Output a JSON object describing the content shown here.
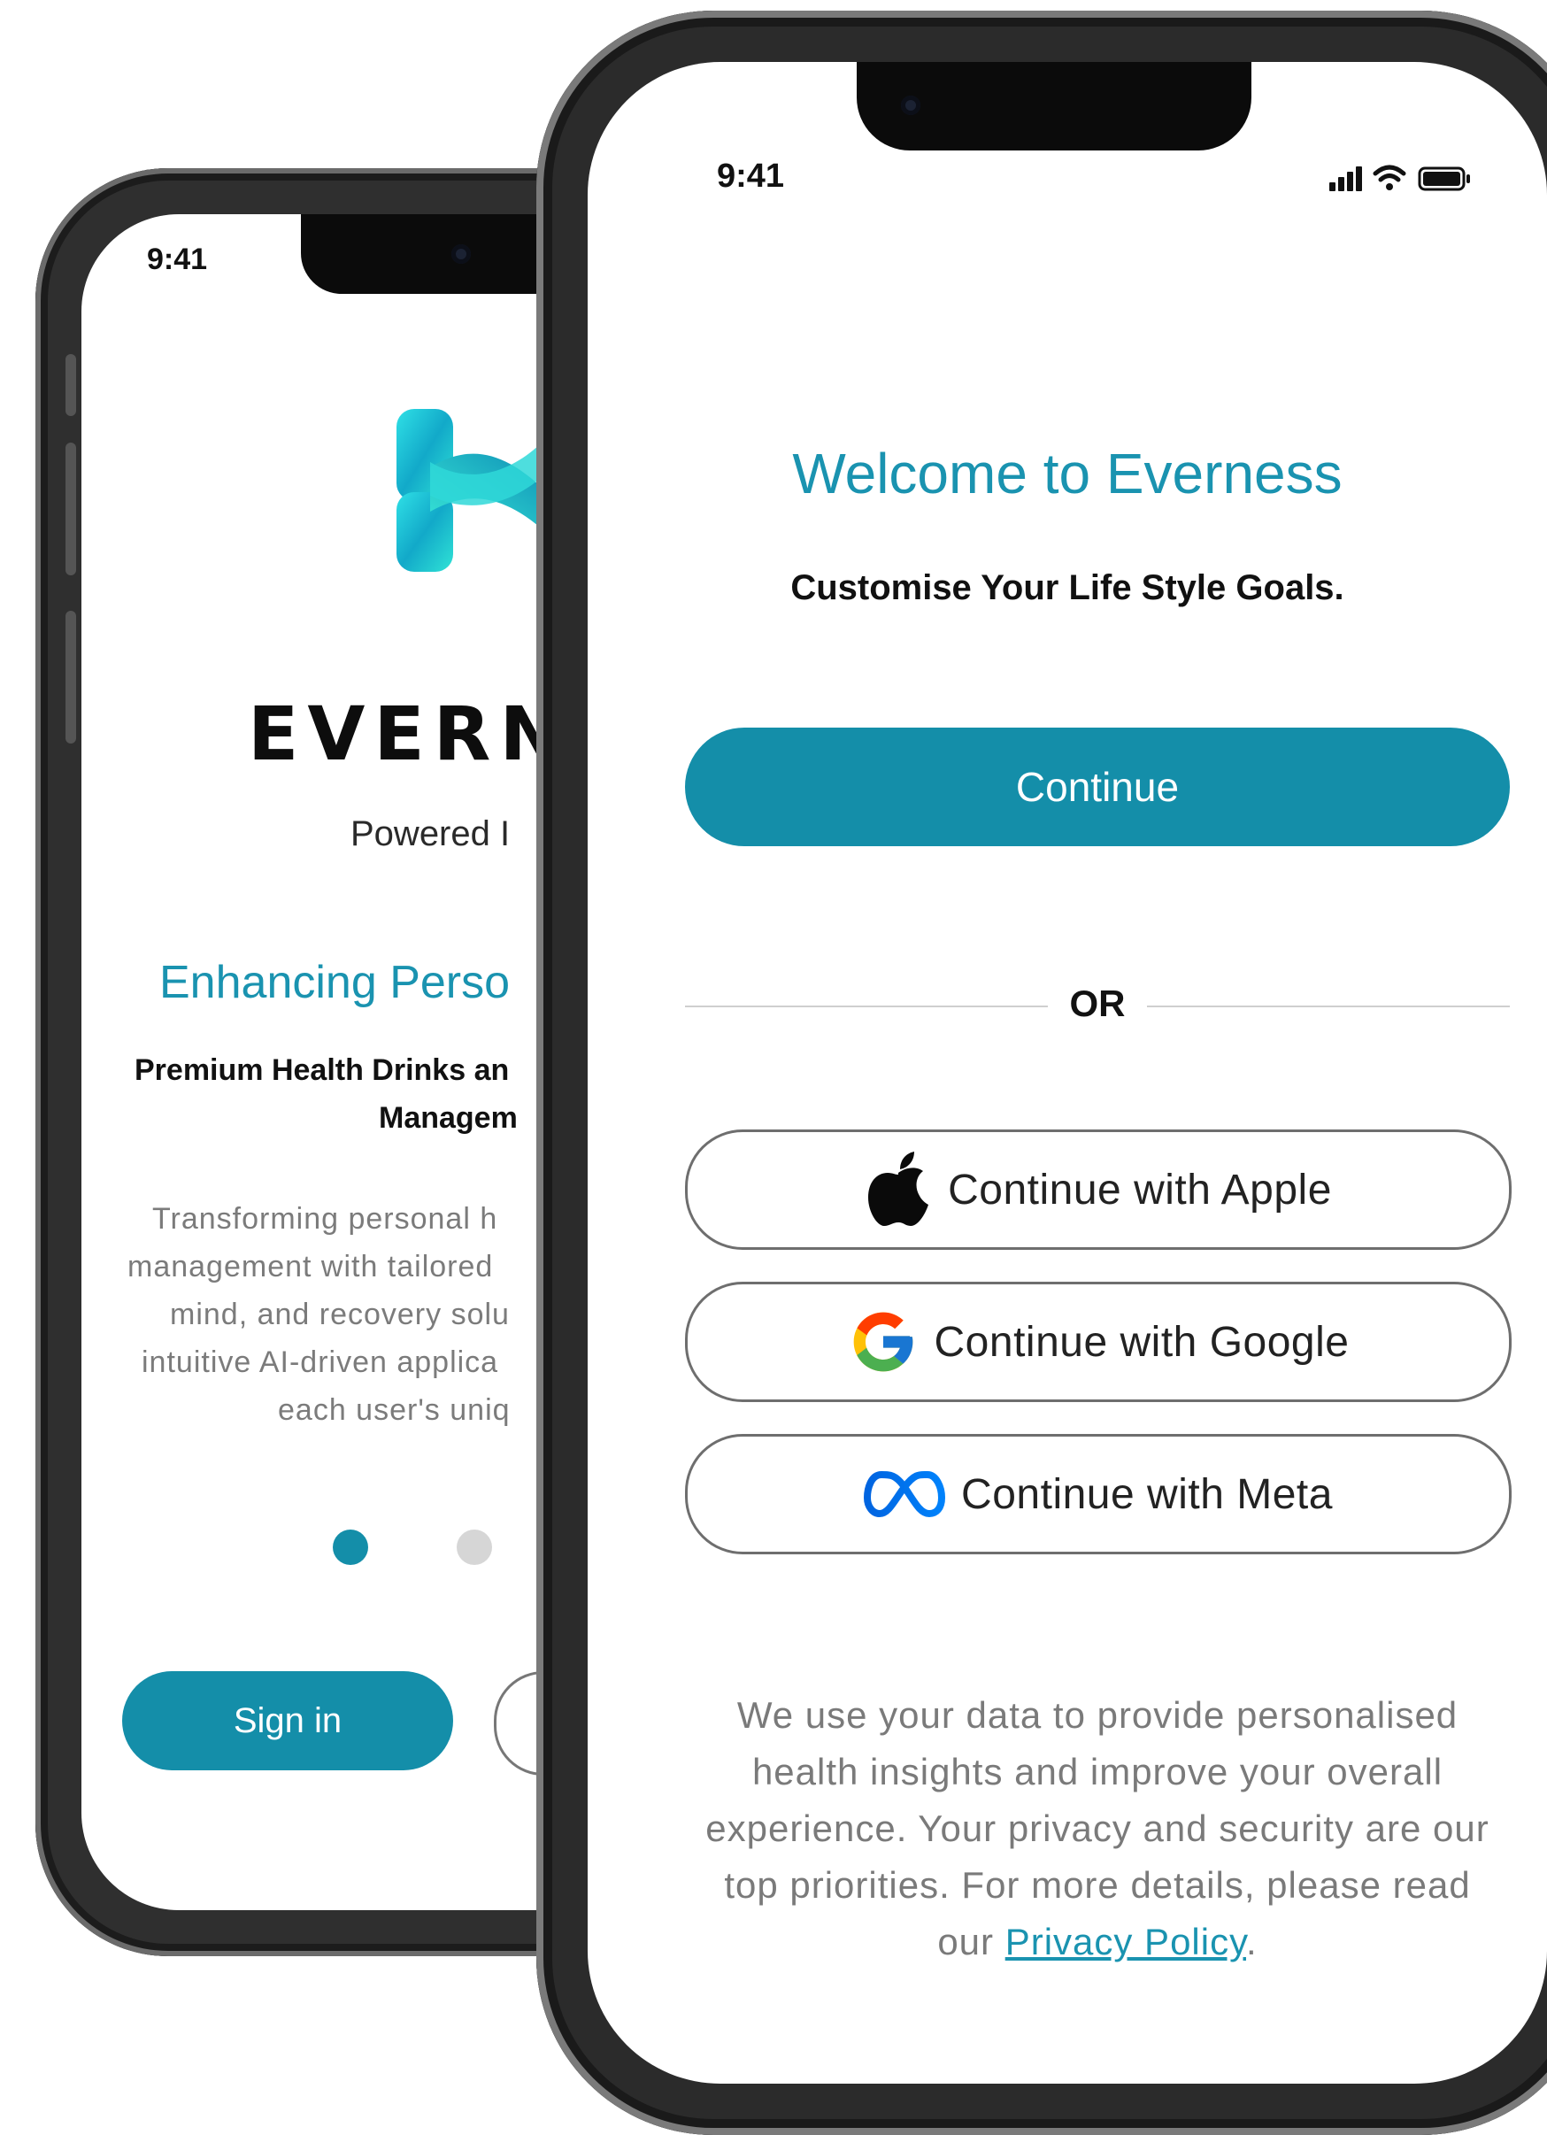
{
  "back_screen": {
    "status_time": "9:41",
    "brand": "EVERN",
    "powered": "Powered I",
    "headline": "Enhancing Perso",
    "subtitle_line1": "Premium Health Drinks an",
    "subtitle_line2": "Managem",
    "body_lines": [
      "Transforming personal h",
      "management with tailored",
      "mind, and recovery solu",
      "intuitive AI-driven applica",
      "each user's uniq"
    ],
    "pager": {
      "active_index": 0,
      "dot_count": 2
    },
    "signin_label": "Sign in"
  },
  "front_screen": {
    "status_time": "9:41",
    "welcome_title": "Welcome to Everness",
    "tagline": "Customise Your Life Style Goals.",
    "continue_label": "Continue",
    "or_label": "OR",
    "social_buttons": {
      "apple": {
        "label": "Continue with Apple",
        "icon": "apple-icon"
      },
      "google": {
        "label": "Continue with Google",
        "icon": "google-icon"
      },
      "meta": {
        "label": "Continue with Meta",
        "icon": "meta-icon"
      }
    },
    "privacy_lines": [
      "We use your data to provide personalised",
      "health insights and improve your overall",
      "experience. Your privacy and security are our",
      "top priorities. For more details, please read"
    ],
    "privacy_prefix": "our ",
    "privacy_link": "Privacy Policy",
    "privacy_suffix": "."
  },
  "colors": {
    "accent": "#148ea9",
    "title_teal": "#1a93b0",
    "dot_inactive": "#d6d6d6"
  }
}
